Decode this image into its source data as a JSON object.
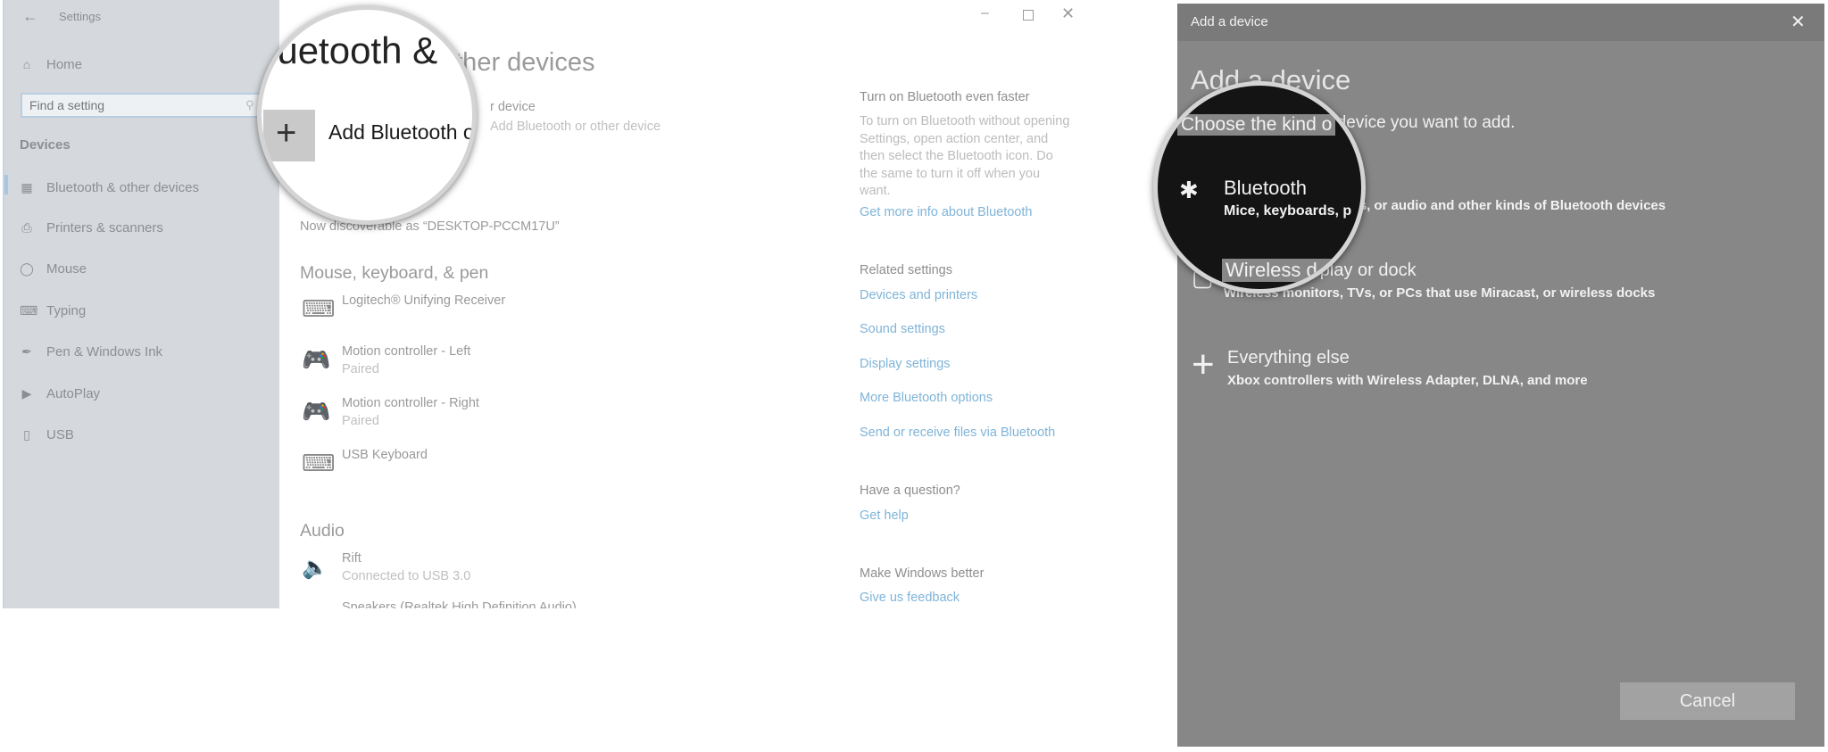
{
  "settings": {
    "title": "Settings",
    "home": "Home",
    "search_placeholder": "Find a setting",
    "section": "Devices",
    "nav": [
      {
        "label": "Bluetooth & other devices",
        "icon": "bluetooth-devices-icon",
        "selected": true
      },
      {
        "label": "Printers & scanners",
        "icon": "printer-icon"
      },
      {
        "label": "Mouse",
        "icon": "mouse-icon"
      },
      {
        "label": "Typing",
        "icon": "keyboard-icon"
      },
      {
        "label": "Pen & Windows Ink",
        "icon": "pen-icon"
      },
      {
        "label": "AutoPlay",
        "icon": "autoplay-icon"
      },
      {
        "label": "USB",
        "icon": "usb-icon"
      }
    ],
    "page_title": "Bluetooth & other devices",
    "page_title_magnified": "luetooth &",
    "add_device_label": "Add Bluetooth or other device",
    "add_device_tail": "r device",
    "add_device_magnified": "Add Bluetooth o",
    "bluetooth_fragment": "th",
    "discoverable": "Now discoverable as “DESKTOP-PCCM17U”",
    "mkp_heading": "Mouse, keyboard, & pen",
    "devices": [
      {
        "name": "Logitech® Unifying Receiver",
        "status": "",
        "icon": "keyboard-mouse-icon"
      },
      {
        "name": "Motion controller - Left",
        "status": "Paired",
        "icon": "gamepad-icon"
      },
      {
        "name": "Motion controller - Right",
        "status": "Paired",
        "icon": "gamepad-icon"
      },
      {
        "name": "USB Keyboard",
        "status": "",
        "icon": "keyboard-icon"
      }
    ],
    "audio_heading": "Audio",
    "audio": [
      {
        "name": "Rift",
        "status": "Connected to USB 3.0",
        "icon": "speaker-icon"
      },
      {
        "name": "Speakers (Realtek High Definition Audio)",
        "status": "",
        "icon": "speaker-icon"
      }
    ],
    "side": {
      "faster_heading": "Turn on Bluetooth even faster",
      "faster_text": "To turn on Bluetooth without opening Settings, open action center, and then select the Bluetooth icon. Do the same to turn it off when you want.",
      "more_info": "Get more info about Bluetooth",
      "related_heading": "Related settings",
      "related": [
        "Devices and printers",
        "Sound settings",
        "Display settings",
        "More Bluetooth options",
        "Send or receive files via Bluetooth"
      ],
      "question_heading": "Have a question?",
      "get_help": "Get help",
      "better_heading": "Make Windows better",
      "feedback": "Give us feedback"
    }
  },
  "dialog": {
    "title": "Add a device",
    "heading": "Add a device",
    "subheading": "Choose the kind of device you want to add.",
    "subheading_magnified": "Choose the kind o",
    "options": [
      {
        "label": "Bluetooth",
        "desc": "Mice, keyboards, pens, or audio and other kinds of Bluetooth devices",
        "icon": "bluetooth-icon"
      },
      {
        "label": "Wireless display or dock",
        "desc": "Wireless monitors, TVs, or PCs that use Miracast, or wireless docks",
        "icon": "monitor-icon"
      },
      {
        "label": "Everything else",
        "desc": "Xbox controllers with Wireless Adapter, DLNA, and more",
        "icon": "plus-icon"
      }
    ],
    "magnified_desc": "Mice, keyboards, p",
    "magnified_wireless": "Wireless d",
    "cancel": "Cancel"
  }
}
